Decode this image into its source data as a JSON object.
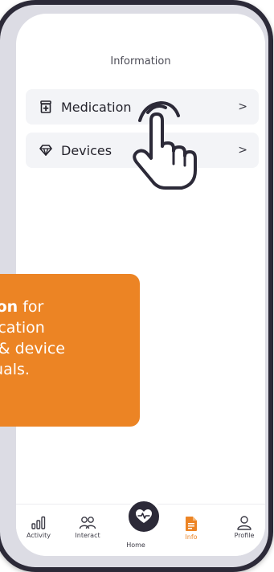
{
  "screen": {
    "title": "Information"
  },
  "menu": {
    "items": [
      {
        "label": "Medication",
        "icon": "medication-icon",
        "chevron": ">"
      },
      {
        "label": "Devices",
        "icon": "diamond-icon",
        "chevron": ">"
      }
    ]
  },
  "callout": {
    "line1_bold": "tion",
    "line1_rest": " for",
    "line2": "dication",
    "line3": "e & device",
    "line4": "nuals."
  },
  "nav": {
    "activity": "Activity",
    "interact": "Interact",
    "home": "Home",
    "info": "Info",
    "profile": "Profile"
  },
  "colors": {
    "accent": "#ec8424",
    "dark": "#2c2a38",
    "row_bg": "#f3f4f7"
  }
}
